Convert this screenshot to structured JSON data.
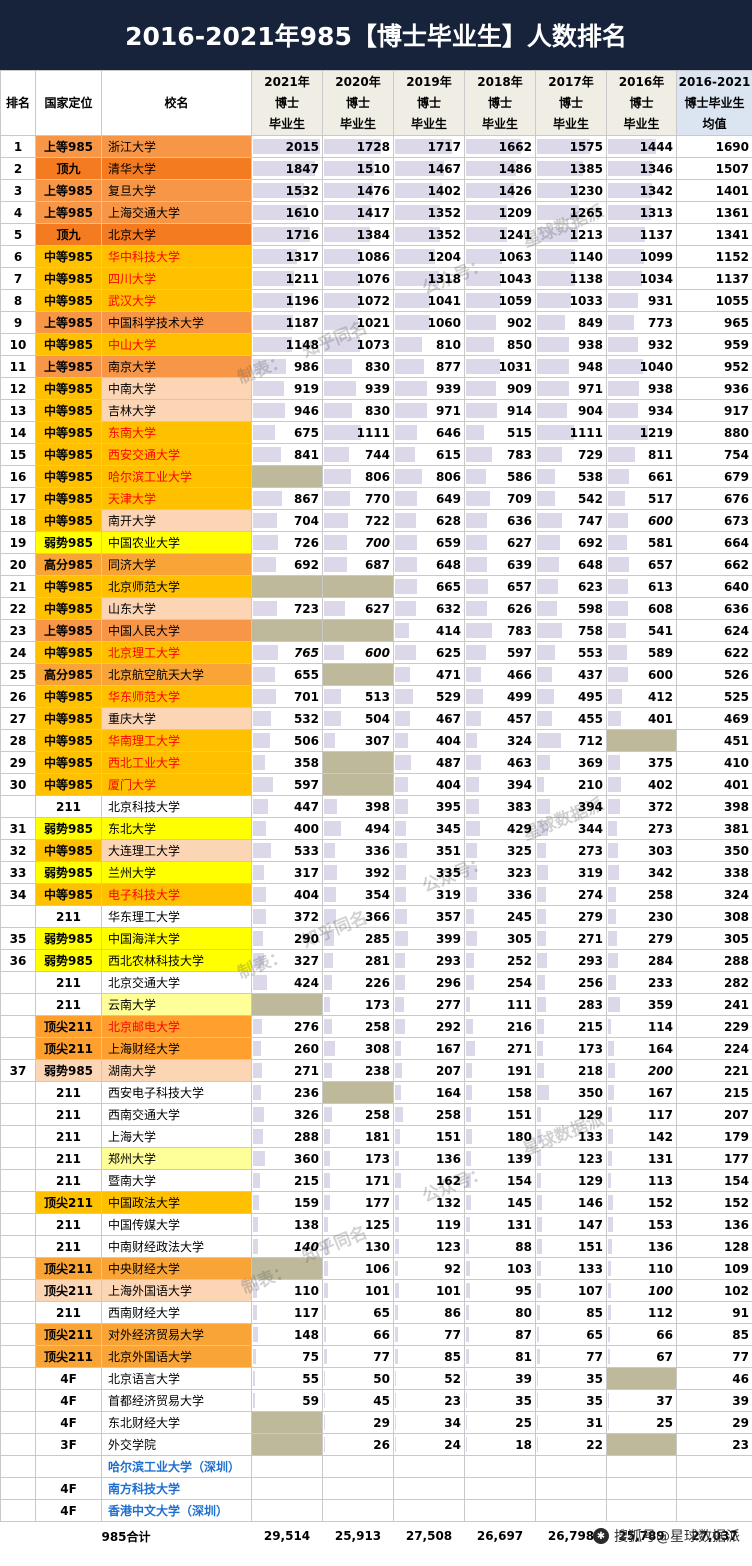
{
  "title": "2016-2021年985【博士毕业生】人数排名",
  "header": {
    "rank": "排名",
    "tier": "国家定位",
    "school": "校名",
    "years": [
      [
        "2021年",
        "博士",
        "毕业生"
      ],
      [
        "2020年",
        "博士",
        "毕业生"
      ],
      [
        "2019年",
        "博士",
        "毕业生"
      ],
      [
        "2018年",
        "博士",
        "毕业生"
      ],
      [
        "2017年",
        "博士",
        "毕业生"
      ],
      [
        "2016年",
        "博士",
        "毕业生"
      ]
    ],
    "avg": [
      "2016-2021",
      "博士毕业生",
      "均值"
    ]
  },
  "colors": {
    "title_bg": "#16233b",
    "top9": "#f47b20",
    "upper985": "#f79646",
    "mid985": "#ffc000",
    "high985": "#f9a437",
    "weak985": "#ffff00",
    "top211": "#ffa02e",
    "light_peach": "#fcd5b4",
    "light_yellow": "#ffff99",
    "red_text": "#ff0000",
    "blue_text": "#1f6fd0",
    "missing": "#bdb99a",
    "bar": "#dcd8ea"
  },
  "rows": [
    {
      "rank": "1",
      "tier": "上等985",
      "name": "浙江大学",
      "vals": [
        "2015",
        "1728",
        "1717",
        "1662",
        "1575",
        "1444"
      ],
      "avg": "1690",
      "tierBg": "#f79646",
      "nameBg": "#f79646",
      "red": false
    },
    {
      "rank": "2",
      "tier": "顶九",
      "name": "清华大学",
      "vals": [
        "1847",
        "1510",
        "1467",
        "1486",
        "1385",
        "1346"
      ],
      "avg": "1507",
      "tierBg": "#f47b20",
      "nameBg": "#f47b20",
      "red": false
    },
    {
      "rank": "3",
      "tier": "上等985",
      "name": "复旦大学",
      "vals": [
        "1532",
        "1476",
        "1402",
        "1426",
        "1230",
        "1342"
      ],
      "avg": "1401",
      "tierBg": "#f79646",
      "nameBg": "#f79646",
      "red": false
    },
    {
      "rank": "4",
      "tier": "上等985",
      "name": "上海交通大学",
      "vals": [
        "1610",
        "1417",
        "1352",
        "1209",
        "1265",
        "1313"
      ],
      "avg": "1361",
      "tierBg": "#f79646",
      "nameBg": "#f79646",
      "red": false
    },
    {
      "rank": "5",
      "tier": "顶九",
      "name": "北京大学",
      "vals": [
        "1716",
        "1384",
        "1352",
        "1241",
        "1213",
        "1137"
      ],
      "avg": "1341",
      "tierBg": "#f47b20",
      "nameBg": "#f47b20",
      "red": false
    },
    {
      "rank": "6",
      "tier": "中等985",
      "name": "华中科技大学",
      "vals": [
        "1317",
        "1086",
        "1204",
        "1063",
        "1140",
        "1099"
      ],
      "avg": "1152",
      "tierBg": "#ffc000",
      "nameBg": "#ffc000",
      "red": true
    },
    {
      "rank": "7",
      "tier": "中等985",
      "name": "四川大学",
      "vals": [
        "1211",
        "1076",
        "1318",
        "1043",
        "1138",
        "1034"
      ],
      "avg": "1137",
      "tierBg": "#ffc000",
      "nameBg": "#ffc000",
      "red": true
    },
    {
      "rank": "8",
      "tier": "中等985",
      "name": "武汉大学",
      "vals": [
        "1196",
        "1072",
        "1041",
        "1059",
        "1033",
        "931"
      ],
      "avg": "1055",
      "tierBg": "#ffc000",
      "nameBg": "#ffc000",
      "red": true
    },
    {
      "rank": "9",
      "tier": "上等985",
      "name": "中国科学技术大学",
      "vals": [
        "1187",
        "1021",
        "1060",
        "902",
        "849",
        "773"
      ],
      "avg": "965",
      "tierBg": "#f79646",
      "nameBg": "#f79646",
      "red": false
    },
    {
      "rank": "10",
      "tier": "中等985",
      "name": "中山大学",
      "vals": [
        "1148",
        "1073",
        "810",
        "850",
        "938",
        "932"
      ],
      "avg": "959",
      "tierBg": "#ffc000",
      "nameBg": "#ffc000",
      "red": true
    },
    {
      "rank": "11",
      "tier": "上等985",
      "name": "南京大学",
      "vals": [
        "986",
        "830",
        "877",
        "1031",
        "948",
        "1040"
      ],
      "avg": "952",
      "tierBg": "#f79646",
      "nameBg": "#f79646",
      "red": false
    },
    {
      "rank": "12",
      "tier": "中等985",
      "name": "中南大学",
      "vals": [
        "919",
        "939",
        "939",
        "909",
        "971",
        "938"
      ],
      "avg": "936",
      "tierBg": "#ffc000",
      "nameBg": "#fcd5b4",
      "red": false
    },
    {
      "rank": "13",
      "tier": "中等985",
      "name": "吉林大学",
      "vals": [
        "946",
        "830",
        "971",
        "914",
        "904",
        "934"
      ],
      "avg": "917",
      "tierBg": "#ffc000",
      "nameBg": "#fcd5b4",
      "red": false
    },
    {
      "rank": "14",
      "tier": "中等985",
      "name": "东南大学",
      "vals": [
        "675",
        "1111",
        "646",
        "515",
        "1111",
        "1219"
      ],
      "avg": "880",
      "tierBg": "#ffc000",
      "nameBg": "#ffc000",
      "red": true
    },
    {
      "rank": "15",
      "tier": "中等985",
      "name": "西安交通大学",
      "vals": [
        "841",
        "744",
        "615",
        "783",
        "729",
        "811"
      ],
      "avg": "754",
      "tierBg": "#ffc000",
      "nameBg": "#ffc000",
      "red": true
    },
    {
      "rank": "16",
      "tier": "中等985",
      "name": "哈尔滨工业大学",
      "vals": [
        "",
        "806",
        "806",
        "586",
        "538",
        "661"
      ],
      "avg": "679",
      "tierBg": "#ffc000",
      "nameBg": "#ffc000",
      "red": true
    },
    {
      "rank": "17",
      "tier": "中等985",
      "name": "天津大学",
      "vals": [
        "867",
        "770",
        "649",
        "709",
        "542",
        "517"
      ],
      "avg": "676",
      "tierBg": "#ffc000",
      "nameBg": "#ffc000",
      "red": true
    },
    {
      "rank": "18",
      "tier": "中等985",
      "name": "南开大学",
      "vals": [
        "704",
        "722",
        "628",
        "636",
        "747",
        "600"
      ],
      "avg": "673",
      "tierBg": "#ffc000",
      "nameBg": "#fcd5b4",
      "red": false,
      "italic": [
        5
      ]
    },
    {
      "rank": "19",
      "tier": "弱势985",
      "name": "中国农业大学",
      "vals": [
        "726",
        "700",
        "659",
        "627",
        "692",
        "581"
      ],
      "avg": "664",
      "tierBg": "#ffff00",
      "nameBg": "#ffff00",
      "red": false,
      "italic": [
        1
      ]
    },
    {
      "rank": "20",
      "tier": "高分985",
      "name": "同济大学",
      "vals": [
        "692",
        "687",
        "648",
        "639",
        "648",
        "657"
      ],
      "avg": "662",
      "tierBg": "#f9a437",
      "nameBg": "#f9a437",
      "red": false
    },
    {
      "rank": "21",
      "tier": "中等985",
      "name": "北京师范大学",
      "vals": [
        "",
        "",
        "665",
        "657",
        "623",
        "613"
      ],
      "avg": "640",
      "tierBg": "#ffc000",
      "nameBg": "#ffc000",
      "red": false
    },
    {
      "rank": "22",
      "tier": "中等985",
      "name": "山东大学",
      "vals": [
        "723",
        "627",
        "632",
        "626",
        "598",
        "608"
      ],
      "avg": "636",
      "tierBg": "#ffc000",
      "nameBg": "#fcd5b4",
      "red": false
    },
    {
      "rank": "23",
      "tier": "上等985",
      "name": "中国人民大学",
      "vals": [
        "",
        "",
        "414",
        "783",
        "758",
        "541"
      ],
      "avg": "624",
      "tierBg": "#f79646",
      "nameBg": "#f79646",
      "red": false
    },
    {
      "rank": "24",
      "tier": "中等985",
      "name": "北京理工大学",
      "vals": [
        "765",
        "600",
        "625",
        "597",
        "553",
        "589"
      ],
      "avg": "622",
      "tierBg": "#ffc000",
      "nameBg": "#ffc000",
      "red": true,
      "italic": [
        0,
        1
      ]
    },
    {
      "rank": "25",
      "tier": "高分985",
      "name": "北京航空航天大学",
      "vals": [
        "655",
        "",
        "471",
        "466",
        "437",
        "600"
      ],
      "avg": "526",
      "tierBg": "#f9a437",
      "nameBg": "#f9a437",
      "red": false
    },
    {
      "rank": "26",
      "tier": "中等985",
      "name": "华东师范大学",
      "vals": [
        "701",
        "513",
        "529",
        "499",
        "495",
        "412"
      ],
      "avg": "525",
      "tierBg": "#ffc000",
      "nameBg": "#ffc000",
      "red": true
    },
    {
      "rank": "27",
      "tier": "中等985",
      "name": "重庆大学",
      "vals": [
        "532",
        "504",
        "467",
        "457",
        "455",
        "401"
      ],
      "avg": "469",
      "tierBg": "#ffc000",
      "nameBg": "#fcd5b4",
      "red": false
    },
    {
      "rank": "28",
      "tier": "中等985",
      "name": "华南理工大学",
      "vals": [
        "506",
        "307",
        "404",
        "324",
        "712",
        ""
      ],
      "avg": "451",
      "tierBg": "#ffc000",
      "nameBg": "#ffc000",
      "red": true
    },
    {
      "rank": "29",
      "tier": "中等985",
      "name": "西北工业大学",
      "vals": [
        "358",
        "",
        "487",
        "463",
        "369",
        "375"
      ],
      "avg": "410",
      "tierBg": "#ffc000",
      "nameBg": "#ffc000",
      "red": true
    },
    {
      "rank": "30",
      "tier": "中等985",
      "name": "厦门大学",
      "vals": [
        "597",
        "",
        "404",
        "394",
        "210",
        "402"
      ],
      "avg": "401",
      "tierBg": "#ffc000",
      "nameBg": "#ffc000",
      "red": true
    },
    {
      "rank": "",
      "tier": "211",
      "name": "北京科技大学",
      "vals": [
        "447",
        "398",
        "395",
        "383",
        "394",
        "372"
      ],
      "avg": "398",
      "tierBg": "#ffffff",
      "nameBg": "#ffffff",
      "red": false
    },
    {
      "rank": "31",
      "tier": "弱势985",
      "name": "东北大学",
      "vals": [
        "400",
        "494",
        "345",
        "429",
        "344",
        "273"
      ],
      "avg": "381",
      "tierBg": "#ffff00",
      "nameBg": "#ffff00",
      "red": false
    },
    {
      "rank": "32",
      "tier": "中等985",
      "name": "大连理工大学",
      "vals": [
        "533",
        "336",
        "351",
        "325",
        "273",
        "303"
      ],
      "avg": "350",
      "tierBg": "#ffc000",
      "nameBg": "#fcd5b4",
      "red": false
    },
    {
      "rank": "33",
      "tier": "弱势985",
      "name": "兰州大学",
      "vals": [
        "317",
        "392",
        "335",
        "323",
        "319",
        "342"
      ],
      "avg": "338",
      "tierBg": "#ffff00",
      "nameBg": "#ffff00",
      "red": false
    },
    {
      "rank": "34",
      "tier": "中等985",
      "name": "电子科技大学",
      "vals": [
        "404",
        "354",
        "319",
        "336",
        "274",
        "258"
      ],
      "avg": "324",
      "tierBg": "#ffc000",
      "nameBg": "#ffc000",
      "red": true
    },
    {
      "rank": "",
      "tier": "211",
      "name": "华东理工大学",
      "vals": [
        "372",
        "366",
        "357",
        "245",
        "279",
        "230"
      ],
      "avg": "308",
      "tierBg": "#ffffff",
      "nameBg": "#ffffff",
      "red": false
    },
    {
      "rank": "35",
      "tier": "弱势985",
      "name": "中国海洋大学",
      "vals": [
        "290",
        "285",
        "399",
        "305",
        "271",
        "279"
      ],
      "avg": "305",
      "tierBg": "#ffff00",
      "nameBg": "#ffff00",
      "red": false
    },
    {
      "rank": "36",
      "tier": "弱势985",
      "name": "西北农林科技大学",
      "vals": [
        "327",
        "281",
        "293",
        "252",
        "293",
        "284"
      ],
      "avg": "288",
      "tierBg": "#ffff00",
      "nameBg": "#ffff00",
      "red": false
    },
    {
      "rank": "",
      "tier": "211",
      "name": "北京交通大学",
      "vals": [
        "424",
        "226",
        "296",
        "254",
        "256",
        "233"
      ],
      "avg": "282",
      "tierBg": "#ffffff",
      "nameBg": "#ffffff",
      "red": false
    },
    {
      "rank": "",
      "tier": "211",
      "name": "云南大学",
      "vals": [
        "",
        "173",
        "277",
        "111",
        "283",
        "359"
      ],
      "avg": "241",
      "tierBg": "#ffffff",
      "nameBg": "#ffff99",
      "red": false
    },
    {
      "rank": "",
      "tier": "顶尖211",
      "name": "北京邮电大学",
      "vals": [
        "276",
        "258",
        "292",
        "216",
        "215",
        "114"
      ],
      "avg": "229",
      "tierBg": "#ffa02e",
      "nameBg": "#ffa02e",
      "red": true
    },
    {
      "rank": "",
      "tier": "顶尖211",
      "name": "上海财经大学",
      "vals": [
        "260",
        "308",
        "167",
        "271",
        "173",
        "164"
      ],
      "avg": "224",
      "tierBg": "#ffa02e",
      "nameBg": "#ffa02e",
      "red": false
    },
    {
      "rank": "37",
      "tier": "弱势985",
      "name": "湖南大学",
      "vals": [
        "271",
        "238",
        "207",
        "191",
        "218",
        "200"
      ],
      "avg": "221",
      "tierBg": "#fcd5b4",
      "nameBg": "#fcd5b4",
      "red": false,
      "italic": [
        5
      ]
    },
    {
      "rank": "",
      "tier": "211",
      "name": "西安电子科技大学",
      "vals": [
        "236",
        "",
        "164",
        "158",
        "350",
        "167"
      ],
      "avg": "215",
      "tierBg": "#ffffff",
      "nameBg": "#ffffff",
      "red": false
    },
    {
      "rank": "",
      "tier": "211",
      "name": "西南交通大学",
      "vals": [
        "326",
        "258",
        "258",
        "151",
        "129",
        "117"
      ],
      "avg": "207",
      "tierBg": "#ffffff",
      "nameBg": "#ffffff",
      "red": false
    },
    {
      "rank": "",
      "tier": "211",
      "name": "上海大学",
      "vals": [
        "288",
        "181",
        "151",
        "180",
        "133",
        "142"
      ],
      "avg": "179",
      "tierBg": "#ffffff",
      "nameBg": "#ffffff",
      "red": false
    },
    {
      "rank": "",
      "tier": "211",
      "name": "郑州大学",
      "vals": [
        "360",
        "173",
        "136",
        "139",
        "123",
        "131"
      ],
      "avg": "177",
      "tierBg": "#ffffff",
      "nameBg": "#ffff99",
      "red": false
    },
    {
      "rank": "",
      "tier": "211",
      "name": "暨南大学",
      "vals": [
        "215",
        "171",
        "162",
        "154",
        "129",
        "113"
      ],
      "avg": "154",
      "tierBg": "#ffffff",
      "nameBg": "#ffffff",
      "red": false
    },
    {
      "rank": "",
      "tier": "顶尖211",
      "name": "中国政法大学",
      "vals": [
        "159",
        "177",
        "132",
        "145",
        "146",
        "152"
      ],
      "avg": "152",
      "tierBg": "#ffc000",
      "nameBg": "#ffc000",
      "red": false
    },
    {
      "rank": "",
      "tier": "211",
      "name": "中国传媒大学",
      "vals": [
        "138",
        "125",
        "119",
        "131",
        "147",
        "153"
      ],
      "avg": "136",
      "tierBg": "#ffffff",
      "nameBg": "#ffffff",
      "red": false
    },
    {
      "rank": "",
      "tier": "211",
      "name": "中南财经政法大学",
      "vals": [
        "140",
        "130",
        "123",
        "88",
        "151",
        "136"
      ],
      "avg": "128",
      "tierBg": "#ffffff",
      "nameBg": "#ffffff",
      "red": false,
      "italic": [
        0
      ]
    },
    {
      "rank": "",
      "tier": "顶尖211",
      "name": "中央财经大学",
      "vals": [
        "",
        "106",
        "92",
        "103",
        "133",
        "110"
      ],
      "avg": "109",
      "tierBg": "#f9a437",
      "nameBg": "#f9a437",
      "red": false
    },
    {
      "rank": "",
      "tier": "顶尖211",
      "name": "上海外国语大学",
      "vals": [
        "110",
        "101",
        "101",
        "95",
        "107",
        "100"
      ],
      "avg": "102",
      "tierBg": "#fcd5b4",
      "nameBg": "#fcd5b4",
      "red": false,
      "italic": [
        5
      ]
    },
    {
      "rank": "",
      "tier": "211",
      "name": "西南财经大学",
      "vals": [
        "117",
        "65",
        "86",
        "80",
        "85",
        "112"
      ],
      "avg": "91",
      "tierBg": "#ffffff",
      "nameBg": "#ffffff",
      "red": false
    },
    {
      "rank": "",
      "tier": "顶尖211",
      "name": "对外经济贸易大学",
      "vals": [
        "148",
        "66",
        "77",
        "87",
        "65",
        "66"
      ],
      "avg": "85",
      "tierBg": "#f9a437",
      "nameBg": "#f9a437",
      "red": false
    },
    {
      "rank": "",
      "tier": "顶尖211",
      "name": "北京外国语大学",
      "vals": [
        "75",
        "77",
        "85",
        "81",
        "77",
        "67"
      ],
      "avg": "77",
      "tierBg": "#f9a437",
      "nameBg": "#f9a437",
      "red": false
    },
    {
      "rank": "",
      "tier": "4F",
      "name": "北京语言大学",
      "vals": [
        "55",
        "50",
        "52",
        "39",
        "35",
        ""
      ],
      "avg": "46",
      "tierBg": "#ffffff",
      "nameBg": "#ffffff",
      "red": false
    },
    {
      "rank": "",
      "tier": "4F",
      "name": "首都经济贸易大学",
      "vals": [
        "59",
        "45",
        "23",
        "35",
        "35",
        "37"
      ],
      "avg": "39",
      "tierBg": "#ffffff",
      "nameBg": "#ffffff",
      "red": false
    },
    {
      "rank": "",
      "tier": "4F",
      "name": "东北财经大学",
      "vals": [
        "",
        "29",
        "34",
        "25",
        "31",
        "25"
      ],
      "avg": "29",
      "tierBg": "#ffffff",
      "nameBg": "#ffffff",
      "red": false
    },
    {
      "rank": "",
      "tier": "3F",
      "name": "外交学院",
      "vals": [
        "",
        "26",
        "24",
        "18",
        "22",
        ""
      ],
      "avg": "23",
      "tierBg": "#ffffff",
      "nameBg": "#ffffff",
      "red": false
    },
    {
      "rank": "",
      "tier": "",
      "name": "哈尔滨工业大学（深圳）",
      "vals": [
        "",
        "",
        "",
        "",
        "",
        ""
      ],
      "avg": "",
      "tierBg": "#ffffff",
      "nameBg": "#ffffff",
      "red": false,
      "blue": true,
      "plain": true
    },
    {
      "rank": "",
      "tier": "4F",
      "name": "南方科技大学",
      "vals": [
        "",
        "",
        "",
        "",
        "",
        ""
      ],
      "avg": "",
      "tierBg": "#ffffff",
      "nameBg": "#ffffff",
      "red": false,
      "blue": true,
      "plain": true
    },
    {
      "rank": "",
      "tier": "4F",
      "name": "香港中文大学（深圳）",
      "vals": [
        "",
        "",
        "",
        "",
        "",
        ""
      ],
      "avg": "",
      "tierBg": "#ffffff",
      "nameBg": "#ffffff",
      "red": false,
      "blue": true,
      "plain": true
    }
  ],
  "footer": {
    "label": "985合计",
    "totals": [
      "29,514",
      "25,913",
      "27,508",
      "26,697",
      "26,798",
      "25,789",
      "27,037"
    ]
  },
  "watermarks": [
    "制表：",
    "知乎同名",
    "公众号：",
    "星球数据派"
  ],
  "brand": {
    "icon": "wechat-icon",
    "text": "搜狐号@星球数据派",
    "text2": "星球数据派"
  }
}
